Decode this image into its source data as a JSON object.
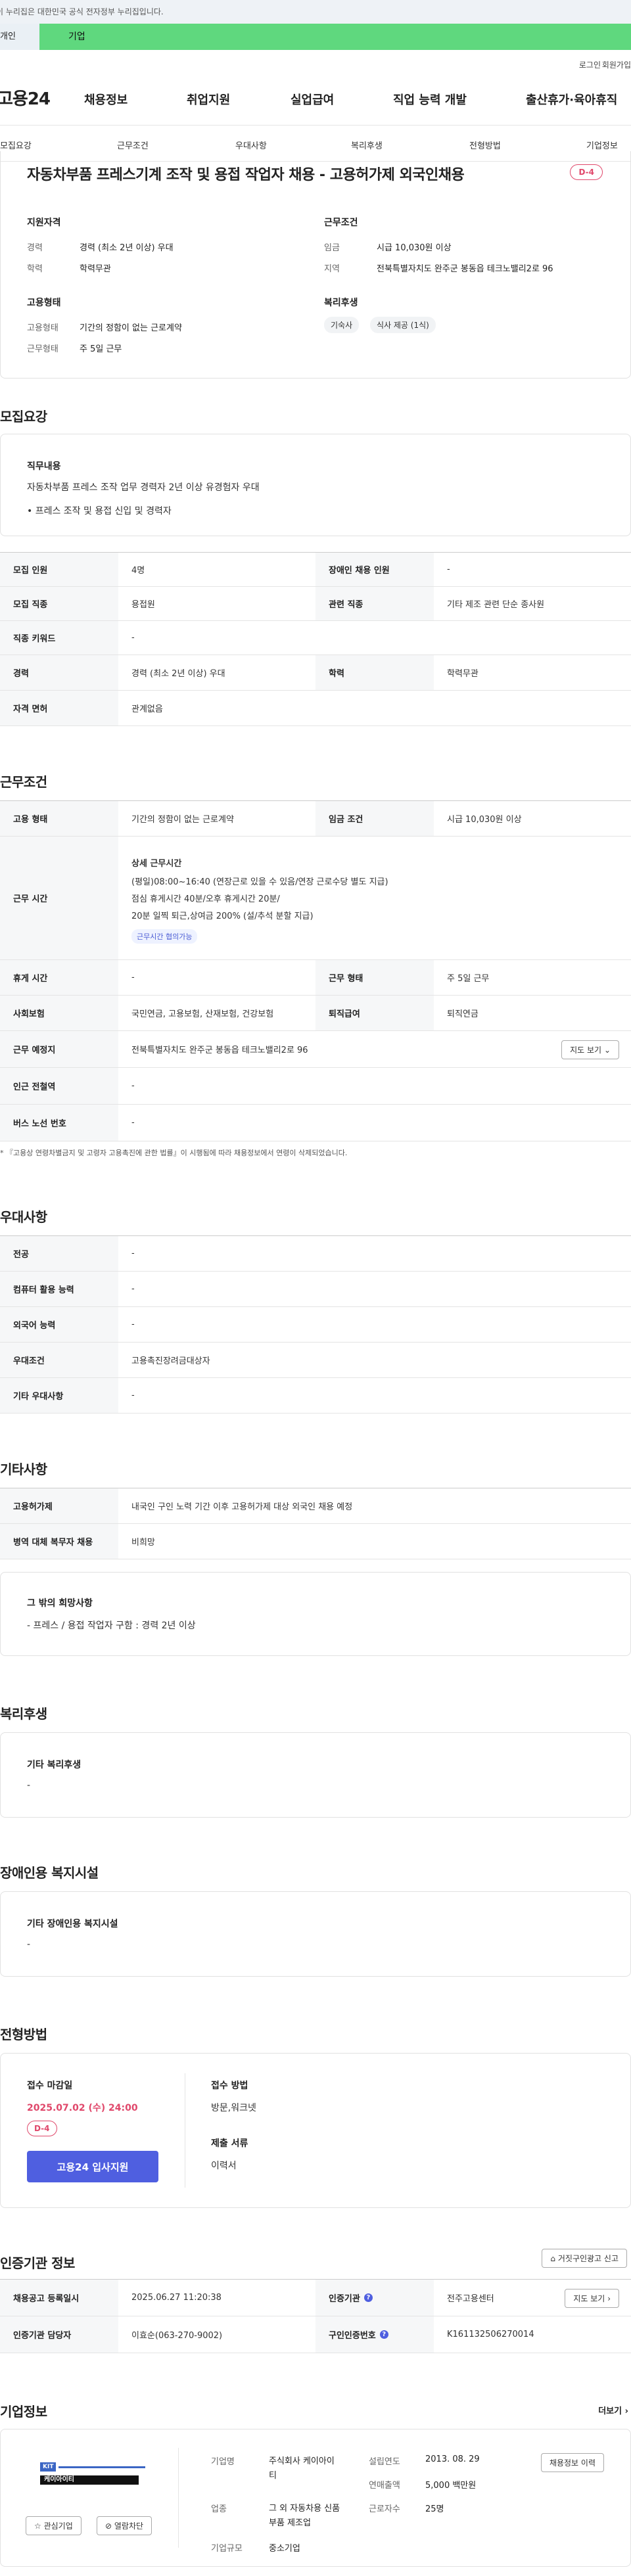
{
  "gov_banner": "이 누리집은 대한민국 공식 전자정부 누리집입니다.",
  "user_switch": {
    "personal": "개인",
    "company": "기업"
  },
  "util": {
    "login": "로그인",
    "join": "회원가입"
  },
  "gnb": {
    "logo": "고용24",
    "menu": [
      "채용정보",
      "취업지원",
      "실업급여",
      "직업 능력 개발",
      "출산휴가·육아휴직"
    ]
  },
  "tabs": [
    "모집요강",
    "근무조건",
    "우대사항",
    "복리후생",
    "전형방법",
    "기업정보"
  ],
  "job": {
    "title": "자동차부품 프레스기계 조작 및 용접 작업자 채용 - 고용허가제 외국인채용",
    "dday": "D-4",
    "qual": {
      "title": "지원자격",
      "career_k": "경력",
      "career_v": "경력 (최소 2년 이상) 우대",
      "edu_k": "학력",
      "edu_v": "학력무관"
    },
    "cond": {
      "title": "근무조건",
      "wage_k": "임금",
      "wage_v": "시급 10,030원 이상",
      "loc_k": "지역",
      "loc_v": "전북특별자치도 완주군 봉동읍 테크노밸리2로 96"
    },
    "emp": {
      "title": "고용형태",
      "type_k": "고용형태",
      "type_v": "기간의 정함이 없는 근로계약",
      "days_k": "근무형태",
      "days_v": "주 5일 근무"
    },
    "welfare": {
      "title": "복리후생",
      "tags": [
        "기숙사",
        "식사 제공 (1식)"
      ]
    }
  },
  "recruit": {
    "section": "모집요강",
    "duty_title": "직무내용",
    "duty_text": "자동차부품 프레스 조작 업무 경력자 2년 이상 유경험자 우대",
    "duty_bullet": "• 프레스 조작 및 용접 신입 및 경력자",
    "rows": [
      {
        "k1": "모집 인원",
        "v1": "4명",
        "k2": "장애인 채용 인원",
        "v2": "-"
      },
      {
        "k1": "모집 직종",
        "v1": "용접원",
        "k2": "관련 직종",
        "v2": "기타 제조 관련 단순 종사원"
      },
      {
        "k1": "직종 키워드",
        "v1": "-"
      },
      {
        "k1": "경력",
        "v1": "경력 (최소 2년 이상) 우대",
        "k2": "학력",
        "v2": "학력무관"
      },
      {
        "k1": "자격 면허",
        "v1": "관계없음"
      }
    ]
  },
  "work": {
    "section": "근무조건",
    "type_k": "고용 형태",
    "type_v": "기간의 정함이 없는 근로계약",
    "wage_k": "임금 조건",
    "wage_v": "시급 10,030원 이상",
    "hours_k": "근무 시간",
    "hours_title": "상세 근무시간",
    "hours_lines": [
      "(평일)08:00~16:40 (연장근로 있을 수 있음/연장 근로수당 별도 지급)",
      "점심 휴게시간 40분/오후 휴게시간 20분/",
      "20분 일찍 퇴근,상여금 200% (설/추석 분할 지급)"
    ],
    "hours_chip": "근무시간 협의가능",
    "rest_k": "휴게 시간",
    "rest_v": "-",
    "form_k": "근무 형태",
    "form_v": "주 5일 근무",
    "ins_k": "사회보험",
    "ins_v": "국민연금, 고용보험, 산재보험, 건강보험",
    "ret_k": "퇴직급여",
    "ret_v": "퇴직연금",
    "place_k": "근무 예정지",
    "place_v": "전북특별자치도 완주군 봉동읍 테크노밸리2로 96",
    "map_btn": "지도 보기",
    "subway_k": "인근 전철역",
    "subway_v": "-",
    "bus_k": "버스 노선 번호",
    "bus_v": "-",
    "note": "* 『고용상 연령차별금지 및 고령자 고용촉진에 관한 법률』이 시행됨에 따라 채용정보에서 연령이 삭제되었습니다."
  },
  "pref": {
    "section": "우대사항",
    "rows": [
      {
        "k": "전공",
        "v": "-"
      },
      {
        "k": "컴퓨터 활용 능력",
        "v": "-"
      },
      {
        "k": "외국어 능력",
        "v": "-"
      },
      {
        "k": "우대조건",
        "v": "고용촉진장려금대상자"
      },
      {
        "k": "기타 우대사항",
        "v": "-"
      }
    ]
  },
  "etc": {
    "section": "기타사항",
    "rows": [
      {
        "k": "고용허가제",
        "v": "내국인 구인 노력 기간 이후 고용허가제 대상 외국인 채용 예정"
      },
      {
        "k": "병역 대체 복무자 채용",
        "v": "비희망"
      }
    ],
    "wish_title": "그 밖의 희망사항",
    "wish_text": "- 프레스 / 용접 작업자 구함 : 경력 2년 이상"
  },
  "welfare": {
    "section": "복리후생",
    "title": "기타 복리후생",
    "value": "-"
  },
  "disab": {
    "section": "장애인용 복지시설",
    "title": "기타 장애인용 복지시설",
    "value": "-"
  },
  "select": {
    "section": "전형방법",
    "deadline_k": "접수 마감일",
    "deadline_v": "2025.07.02 (수) 24:00",
    "dday": "D-4",
    "apply_btn": "고용24 입사지원",
    "method_k": "접수 방법",
    "method_v": "방문,워크넷",
    "docs_k": "제출 서류",
    "docs_v": "이력서"
  },
  "cert": {
    "section": "인증기관 정보",
    "report_btn": "거짓구인광고 신고",
    "reg_k": "채용공고 등록일시",
    "reg_v": "2025.06.27 11:20:38",
    "org_k": "인증기관",
    "org_v": "전주고용센터",
    "map_btn": "지도 보기",
    "mgr_k": "인증기관 담당자",
    "mgr_v": "이효순(063-270-9002)",
    "num_k": "구인인증번호",
    "num_v": "K161132506270014"
  },
  "company": {
    "section": "기업정보",
    "more": "더보기",
    "logo_text": "케이아이티",
    "fav_btn": "관심기업",
    "block_btn": "열람차단",
    "name_k": "기업명",
    "name_v": "주식회사 케이아이티",
    "biz_k": "업종",
    "biz_v": "그 외 자동차용 신품 부품 제조업",
    "size_k": "기업규모",
    "size_v": "중소기업",
    "est_k": "설립연도",
    "est_v": "2013. 08. 29",
    "sales_k": "연매출액",
    "sales_v": "5,000 백만원",
    "emp_k": "근로자수",
    "emp_v": "25명",
    "jobs_btn": "채용정보 이력"
  }
}
